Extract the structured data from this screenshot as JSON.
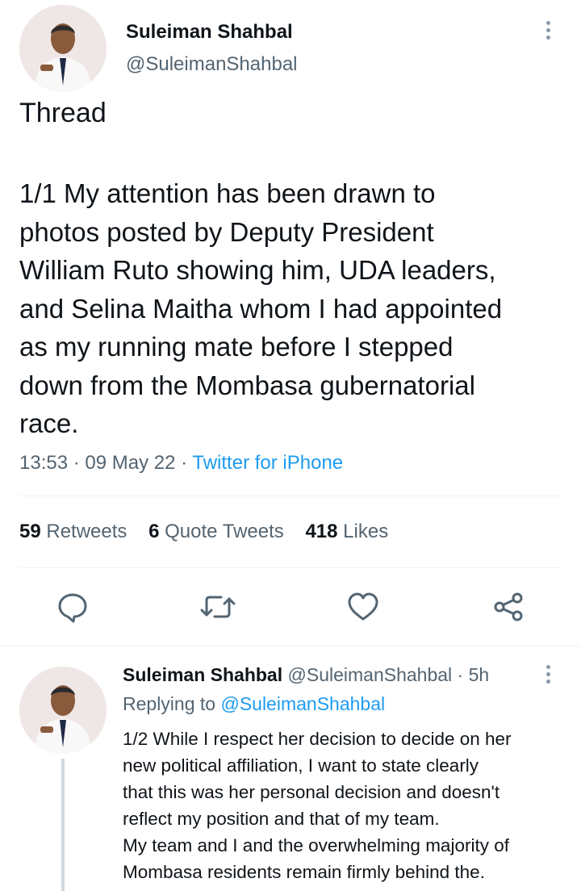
{
  "tweet": {
    "author_name": "Suleiman Shahbal",
    "author_handle": "@SuleimanShahbal",
    "label": "Thread",
    "lines": [
      "1/1 My attention has been drawn to",
      "photos posted by Deputy President",
      "William Ruto showing him, UDA leaders,",
      "and Selina Maitha whom I had appointed",
      "as my running mate before I stepped",
      "down from the Mombasa gubernatorial",
      "race."
    ],
    "time": "13:53",
    "sep1": "·",
    "date": "09 May 22",
    "sep2": "·",
    "source": "Twitter for iPhone",
    "stats": {
      "retweets_count": "59",
      "retweets_label": "Retweets",
      "quotes_count": "6",
      "quotes_label": "Quote Tweets",
      "likes_count": "418",
      "likes_label": "Likes"
    }
  },
  "actions": [
    "reply-icon",
    "retweet-icon",
    "like-icon",
    "share-icon"
  ],
  "reply": {
    "author_name": "Suleiman Shahbal",
    "author_handle": "@SuleimanShahbal",
    "sep": "·",
    "age": "5h",
    "replying_label": "Replying to",
    "replying_handle": "@SuleimanShahbal",
    "lines": [
      "1/2 While I respect her decision to decide on her",
      "new political affiliation, I want to state clearly",
      "that this was her personal decision and doesn't",
      "reflect my position and that of my team.",
      "My team and I and the overwhelming majority of",
      "Mombasa residents remain firmly behind the."
    ]
  },
  "colors": {
    "accent": "#1d9bf0",
    "text": "#0f1419",
    "muted": "#536471",
    "divider": "#eff3f4"
  }
}
